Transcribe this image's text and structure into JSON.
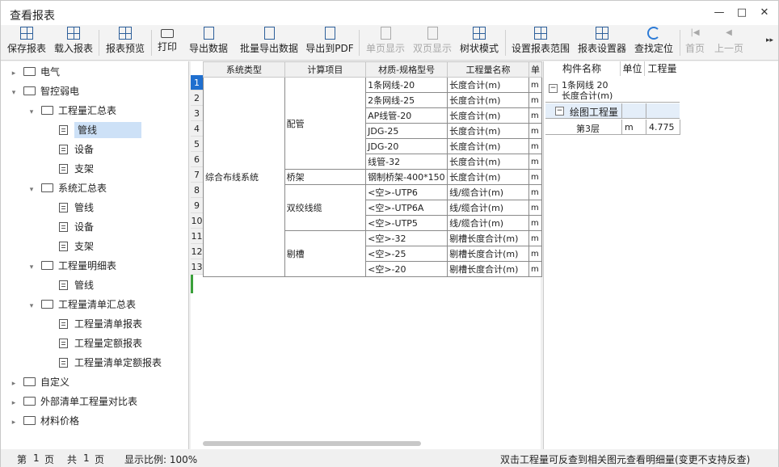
{
  "window": {
    "title": "查看报表"
  },
  "toolbar": {
    "buttons": [
      {
        "label": "保存报表",
        "icon": "save-report-icon"
      },
      {
        "label": "载入报表",
        "icon": "load-report-icon"
      },
      {
        "label": "报表预览",
        "icon": "preview-report-icon"
      },
      {
        "label": "打印",
        "icon": "print-icon"
      },
      {
        "label": "导出数据",
        "icon": "export-data-icon"
      },
      {
        "label": "批量导出数据",
        "icon": "batch-export-icon"
      },
      {
        "label": "导出到PDF",
        "icon": "export-pdf-icon"
      },
      {
        "label": "单页显示",
        "icon": "single-page-icon",
        "disabled": true
      },
      {
        "label": "双页显示",
        "icon": "double-page-icon",
        "disabled": true
      },
      {
        "label": "树状模式",
        "icon": "tree-mode-icon"
      },
      {
        "label": "设置报表范围",
        "icon": "report-range-icon"
      },
      {
        "label": "报表设置器",
        "icon": "report-settings-icon"
      },
      {
        "label": "查找定位",
        "icon": "locate-icon"
      },
      {
        "label": "首页",
        "icon": "first-page-icon",
        "disabled": true
      },
      {
        "label": "上一页",
        "icon": "prev-page-icon",
        "disabled": true
      }
    ]
  },
  "tree": [
    {
      "label": "电气",
      "level": 0,
      "type": "folder",
      "expanded": false
    },
    {
      "label": "智控弱电",
      "level": 0,
      "type": "folder",
      "expanded": true
    },
    {
      "label": "工程量汇总表",
      "level": 1,
      "type": "folder",
      "expanded": true
    },
    {
      "label": "管线",
      "level": 2,
      "type": "doc",
      "selected": true
    },
    {
      "label": "设备",
      "level": 2,
      "type": "doc"
    },
    {
      "label": "支架",
      "level": 2,
      "type": "doc"
    },
    {
      "label": "系统汇总表",
      "level": 1,
      "type": "folder",
      "expanded": true
    },
    {
      "label": "管线",
      "level": 2,
      "type": "doc"
    },
    {
      "label": "设备",
      "level": 2,
      "type": "doc"
    },
    {
      "label": "支架",
      "level": 2,
      "type": "doc"
    },
    {
      "label": "工程量明细表",
      "level": 1,
      "type": "folder",
      "expanded": true
    },
    {
      "label": "管线",
      "level": 2,
      "type": "doc"
    },
    {
      "label": "工程量清单汇总表",
      "level": 1,
      "type": "folder",
      "expanded": true
    },
    {
      "label": "工程量清单报表",
      "level": 2,
      "type": "doc"
    },
    {
      "label": "工程量定额报表",
      "level": 2,
      "type": "doc"
    },
    {
      "label": "工程量清单定额报表",
      "level": 2,
      "type": "doc"
    },
    {
      "label": "自定义",
      "level": 0,
      "type": "folder",
      "expanded": false
    },
    {
      "label": "外部清单工程量对比表",
      "level": 0,
      "type": "folder",
      "expanded": false
    },
    {
      "label": "材料价格",
      "level": 0,
      "type": "folder",
      "expanded": false
    }
  ],
  "report": {
    "headers": [
      "系统类型",
      "计算项目",
      "材质-规格型号",
      "工程量名称",
      "单"
    ],
    "system_type": "综合布线系统",
    "groups": [
      {
        "name": "配管",
        "rows": 6
      },
      {
        "name": "桥架",
        "rows": 1
      },
      {
        "name": "双绞线缆",
        "rows": 3
      },
      {
        "name": "剔槽",
        "rows": 3
      }
    ],
    "rows": [
      {
        "num": "1",
        "spec": "1条网线-20",
        "qty_name": "长度合计(m)",
        "unit": "m"
      },
      {
        "num": "2",
        "spec": "2条网线-25",
        "qty_name": "长度合计(m)",
        "unit": "m"
      },
      {
        "num": "3",
        "spec": "AP线管-20",
        "qty_name": "长度合计(m)",
        "unit": "m"
      },
      {
        "num": "4",
        "spec": "JDG-25",
        "qty_name": "长度合计(m)",
        "unit": "m"
      },
      {
        "num": "5",
        "spec": "JDG-20",
        "qty_name": "长度合计(m)",
        "unit": "m"
      },
      {
        "num": "6",
        "spec": "线管-32",
        "qty_name": "长度合计(m)",
        "unit": "m"
      },
      {
        "num": "7",
        "spec": "钢制桥架-400*150",
        "qty_name": "长度合计(m)",
        "unit": "m"
      },
      {
        "num": "8",
        "spec": "<空>-UTP6",
        "qty_name": "线/缆合计(m)",
        "unit": "m"
      },
      {
        "num": "9",
        "spec": "<空>-UTP6A",
        "qty_name": "线/缆合计(m)",
        "unit": "m"
      },
      {
        "num": "10",
        "spec": "<空>-UTP5",
        "qty_name": "线/缆合计(m)",
        "unit": "m"
      },
      {
        "num": "11",
        "spec": "<空>-32",
        "qty_name": "剔槽长度合计(m)",
        "unit": "m"
      },
      {
        "num": "12",
        "spec": "<空>-25",
        "qty_name": "剔槽长度合计(m)",
        "unit": "m"
      },
      {
        "num": "13",
        "spec": "<空>-20",
        "qty_name": "剔槽长度合计(m)",
        "unit": "m"
      }
    ],
    "active_row": "1"
  },
  "detail": {
    "headers": [
      "构件名称",
      "单位",
      "工程量"
    ],
    "root_line1": "1条网线 20",
    "root_line2": "长度合计(m)",
    "group": "绘图工程量",
    "item": {
      "name": "第3层",
      "unit": "m",
      "qty": "4.775"
    }
  },
  "status": {
    "page_label": "第",
    "page_num": "1",
    "page_unit": "页",
    "total_label": "共",
    "total_num": "1",
    "total_unit": "页",
    "zoom": "显示比例: 100%",
    "hint": "双击工程量可反查到相关图元查看明细量(变更不支持反查)"
  }
}
